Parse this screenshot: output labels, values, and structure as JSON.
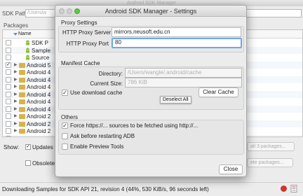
{
  "main_window": {
    "title": "Android SDK Manager",
    "sdk_path_label": "SDK Path:",
    "sdk_path_value": "/Users/w",
    "packages_label": "Packages",
    "name_column": "Name",
    "packages": [
      {
        "name": "SDK P",
        "checked": false,
        "kind": "android",
        "indent": 2
      },
      {
        "name": "Sample",
        "checked": false,
        "kind": "android",
        "indent": 2
      },
      {
        "name": "Source",
        "checked": false,
        "kind": "android",
        "indent": 2
      },
      {
        "name": "Android 5",
        "checked": true,
        "kind": "folder",
        "indent": 0
      },
      {
        "name": "Android 4",
        "checked": false,
        "kind": "folder",
        "indent": 0
      },
      {
        "name": "Android 4",
        "checked": false,
        "kind": "folder",
        "indent": 0
      },
      {
        "name": "Android 4",
        "checked": false,
        "kind": "folder",
        "indent": 0
      },
      {
        "name": "Android 4",
        "checked": false,
        "kind": "folder",
        "indent": 0
      },
      {
        "name": "Android 4",
        "checked": false,
        "kind": "folder",
        "indent": 0
      },
      {
        "name": "Android 4",
        "checked": false,
        "kind": "folder",
        "indent": 0
      },
      {
        "name": "Android 2",
        "checked": false,
        "kind": "folder",
        "indent": 0
      },
      {
        "name": "Android 2",
        "checked": false,
        "kind": "folder",
        "indent": 0
      },
      {
        "name": "Android 2",
        "checked": false,
        "kind": "folder",
        "indent": 0
      },
      {
        "name": "Extras",
        "checked": false,
        "kind": "folder",
        "indent": 0
      }
    ],
    "show_label": "Show:",
    "updates_label": "Updates",
    "updates_checked": true,
    "obsolete_label": "Obsolete",
    "install_button": "all 3 packages...",
    "delete_button": "ete packages...",
    "status_text": "Downloading Samples for SDK API 21, revision 4 (44%, 530 KiB/s, 96 seconds left)"
  },
  "dialog": {
    "title": "Android SDK Manager - Settings",
    "proxy_section": "Proxy Settings",
    "proxy_server_label": "HTTP Proxy Server",
    "proxy_server_value": "mirrors.neusoft.edu.cn",
    "proxy_port_label": "HTTP Proxy Port",
    "proxy_port_value": "80",
    "cache_section": "Manifest Cache",
    "directory_label": "Directory:",
    "directory_value": "/Users/wangle/.android/cache",
    "size_label": "Current Size:",
    "size_value": "786 KiB",
    "use_cache_label": "Use download cache",
    "use_cache_checked": true,
    "clear_cache_button": "Clear Cache",
    "tooltip": "Deselect All",
    "others_section": "Others",
    "force_https_label": "Force https://... sources to be fetched using http://...",
    "force_https_checked": true,
    "ask_restart_label": "Ask before restarting ADB",
    "ask_restart_checked": false,
    "preview_label": "Enable Preview Tools",
    "preview_checked": false,
    "close_button": "Close"
  },
  "colors": {
    "focus_ring": "#6fa7e6",
    "folder": "#d9b24a",
    "android_green": "#8bbf3c",
    "stop_red": "#d0342c",
    "traffic_green": "#5ec648"
  }
}
